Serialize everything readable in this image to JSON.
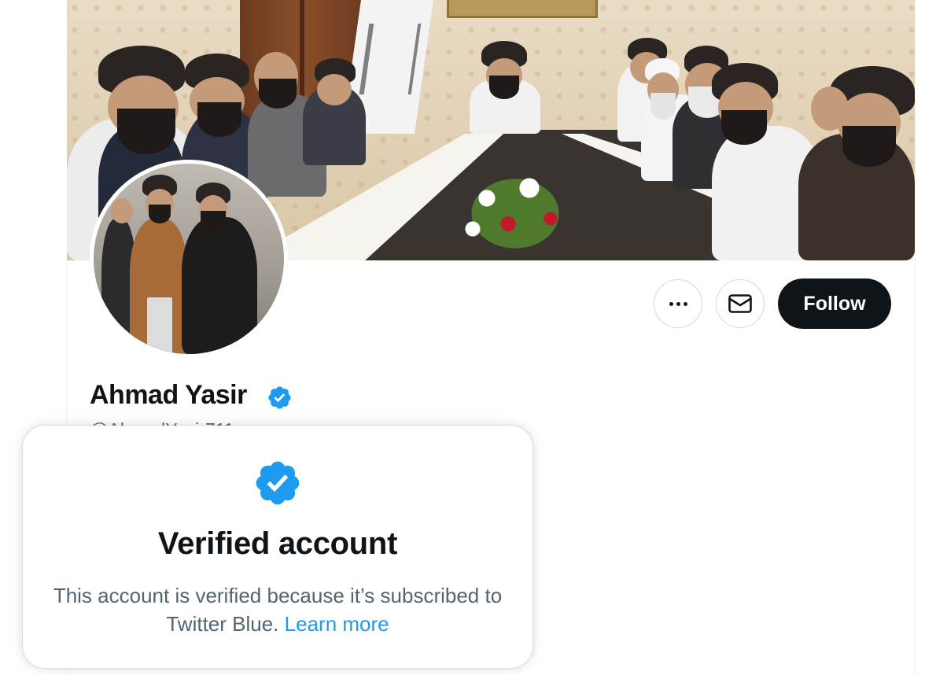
{
  "profile": {
    "display_name": "Ahmad Yasir",
    "handle": "@AhmadYasir711",
    "verified": true
  },
  "actions": {
    "more_label": "More",
    "message_label": "Message",
    "follow_label": "Follow"
  },
  "popover": {
    "title": "Verified account",
    "body": "This account is verified because it’s subscribed to Twitter Blue.",
    "link": "Learn more"
  },
  "colors": {
    "verified_blue": "#1d9bf0",
    "follow_button": "#0f1419",
    "secondary_text": "#536471"
  },
  "icons": {
    "verified": "verified-badge-icon",
    "more": "ellipsis-icon",
    "message": "envelope-icon"
  }
}
